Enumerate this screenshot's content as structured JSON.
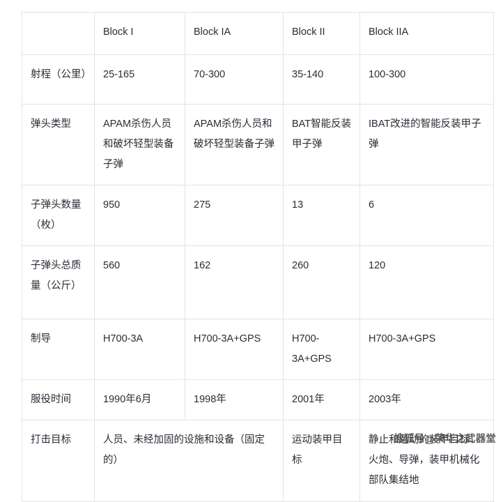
{
  "table": {
    "columns": [
      "",
      "Block I",
      "Block IA",
      "Block II",
      "Block IIA"
    ],
    "rows": [
      {
        "label": "射程（公里）",
        "cells": [
          "25-165",
          "70-300",
          "35-140",
          "100-300"
        ]
      },
      {
        "label": "弹头类型",
        "cells": [
          "APAM杀伤人员和破坏轻型装备子弹",
          "APAM杀伤人员和破坏轻型装备子弹",
          "BAT智能反装甲子弹",
          "IBAT改进的智能反装甲子弹"
        ]
      },
      {
        "label": "子弹头数量（枚）",
        "cells": [
          "950",
          "275",
          "13",
          "6"
        ]
      },
      {
        "label": "子弹头总质量（公斤）",
        "cells": [
          "560",
          "162",
          "260",
          "120"
        ]
      },
      {
        "label": "制导",
        "cells": [
          "H700-3A",
          "H700-3A+GPS",
          "H700-3A+GPS",
          "H700-3A+GPS"
        ]
      },
      {
        "label": "服役时间",
        "cells": [
          "1990年6月",
          "1998年",
          "2001年",
          "2003年"
        ]
      },
      {
        "label": "打击目标",
        "cells": [
          "人员、未经加固的设施和设备（固定的）",
          "运动装甲目标",
          "静止和运动的装甲目标、火炮、导弹，装甲机械化部队集结地"
        ],
        "merged_first_cell_span": 2
      }
    ]
  },
  "watermark": {
    "prefix": "搜狐号",
    "at": "@",
    "account": "荣华之武器堂"
  },
  "colors": {
    "border": "#e3e3e3",
    "text": "#2b2b35",
    "background": "#ffffff",
    "watermark_text": "#4a4a4a"
  }
}
